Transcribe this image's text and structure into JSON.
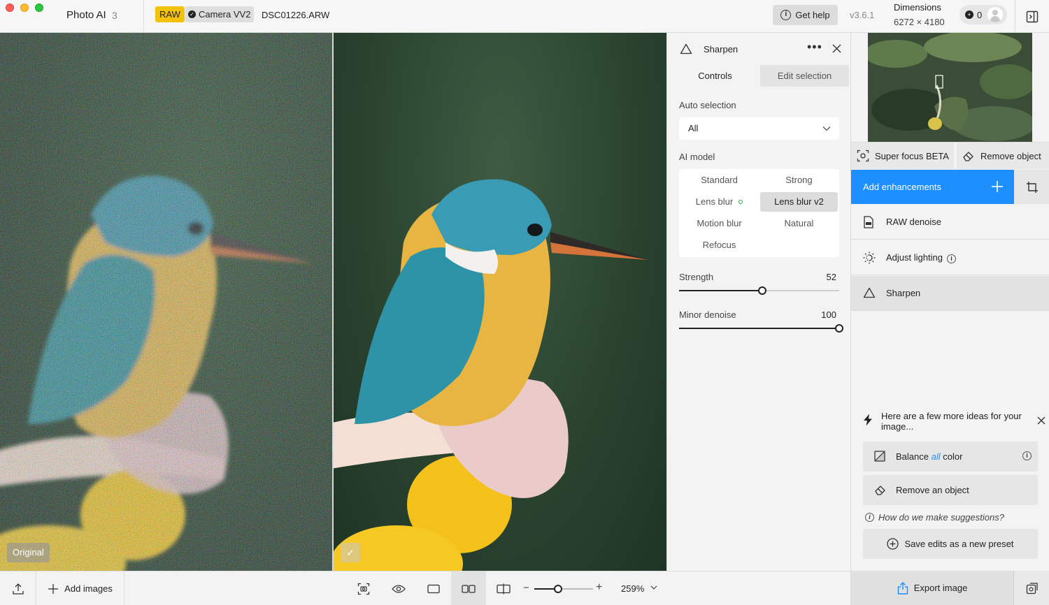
{
  "app": {
    "name": "Photo AI",
    "version_badge": "3"
  },
  "file": {
    "raw_badge": "RAW",
    "camera_badge": "Camera VV2",
    "filename": "DSC01226.ARW"
  },
  "header": {
    "help_label": "Get help",
    "version": "v3.6.1",
    "dimensions_label": "Dimensions",
    "dimensions_value": "6272 × 4180",
    "credits": "0"
  },
  "viewer": {
    "original_label": "Original",
    "check_glyph": "✓"
  },
  "bottom_toolbar": {
    "add_images_label": "Add images",
    "zoom_value": "259%",
    "zoom_slider_level": 0.4,
    "tools": [
      "upload-icon",
      "screenshot-icon",
      "eye-icon",
      "single-view-icon",
      "side-by-side-icon",
      "split-view-icon"
    ]
  },
  "tool_panel": {
    "title": "Sharpen",
    "more_glyph": "•••",
    "tabs": [
      "Controls",
      "Edit selection"
    ],
    "auto_selection_label": "Auto selection",
    "auto_selection_value": "All",
    "ai_model_label": "AI model",
    "models": [
      "Standard",
      "Strong",
      "Lens blur",
      "Lens blur v2",
      "Motion blur",
      "Natural",
      "Refocus"
    ],
    "selected_model": "Lens blur v2",
    "sliders": [
      {
        "label": "Strength",
        "value": "52",
        "level": 0.52
      },
      {
        "label": "Minor denoise",
        "value": "100",
        "level": 1.0
      }
    ]
  },
  "sidebar": {
    "super_focus_label": "Super focus BETA",
    "remove_object_label": "Remove object",
    "add_enhancements_label": "Add enhancements",
    "enhancements": [
      {
        "label": "RAW denoise",
        "icon": "raw-file-icon"
      },
      {
        "label": "Adjust lighting",
        "icon": "light-icon"
      },
      {
        "label": "Sharpen",
        "icon": "triangle-icon"
      }
    ],
    "ideas_text": "Here are a few more ideas for your image...",
    "suggestions": {
      "balance_prefix": "Balance",
      "balance_accent": "all",
      "balance_suffix": "color",
      "remove_object": "Remove an object"
    },
    "how_text": "How do we make suggestions?",
    "preset_label": "Save edits as a new preset",
    "export_label": "Export image"
  },
  "colors": {
    "accent": "#1e8fff",
    "raw_badge": "#f4c20d",
    "model_dot": "#2ba84a"
  }
}
